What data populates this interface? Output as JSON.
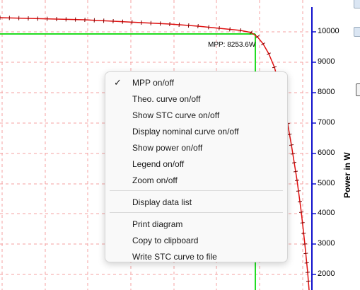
{
  "plot": {
    "y_axis": {
      "title": "Power in W",
      "ticks": [
        "10000",
        "9000",
        "8000",
        "7000",
        "6000",
        "5000",
        "4000",
        "3000",
        "2000"
      ]
    },
    "mpp_label": "MPP: 8253.6W",
    "colors": {
      "curve": "#e01010",
      "mpp_lines": "#22dd22",
      "axis": "#1010cc",
      "grid": "#f08080"
    }
  },
  "context_menu": {
    "items": [
      {
        "label": "MPP on/off",
        "checked": true
      },
      {
        "label": "Theo. curve on/off",
        "checked": false
      },
      {
        "label": "Show STC curve on/off",
        "checked": false
      },
      {
        "label": "Display nominal curve on/off",
        "checked": false
      },
      {
        "label": "Show power on/off",
        "checked": false
      },
      {
        "label": "Legend on/off",
        "checked": false
      },
      {
        "label": "Zoom on/off",
        "checked": false
      },
      {
        "label": "Display data list",
        "checked": false
      },
      {
        "label": "Print diagram",
        "checked": false
      },
      {
        "label": "Copy to clipboard",
        "checked": false
      },
      {
        "label": "Write STC curve to file",
        "checked": false
      }
    ],
    "check_glyph": "✓"
  }
}
